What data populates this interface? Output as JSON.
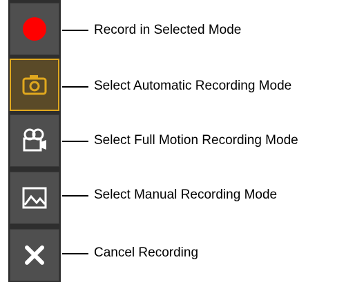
{
  "toolbar": {
    "buttons": [
      {
        "id": "record",
        "icon": "record-dot-icon",
        "color": "#ff0000",
        "selected": false
      },
      {
        "id": "automatic",
        "icon": "camera-icon",
        "color": "#e0a81e",
        "selected": true
      },
      {
        "id": "full_motion",
        "icon": "video-camera-icon",
        "color": "#ffffff",
        "selected": false
      },
      {
        "id": "manual",
        "icon": "image-icon",
        "color": "#ffffff",
        "selected": false
      },
      {
        "id": "cancel",
        "icon": "x-icon",
        "color": "#ffffff",
        "selected": false
      }
    ]
  },
  "callouts": {
    "record": "Record in Selected Mode",
    "automatic": "Select Automatic Recording Mode",
    "full_motion": "Select Full Motion Recording Mode",
    "manual": "Select Manual Recording Mode",
    "cancel": "Cancel Recording"
  },
  "colors": {
    "toolbar_bg": "#2e2e2e",
    "button_bg": "#4f4f4f",
    "selected_border": "#e0a81e",
    "record_red": "#ff0000"
  }
}
